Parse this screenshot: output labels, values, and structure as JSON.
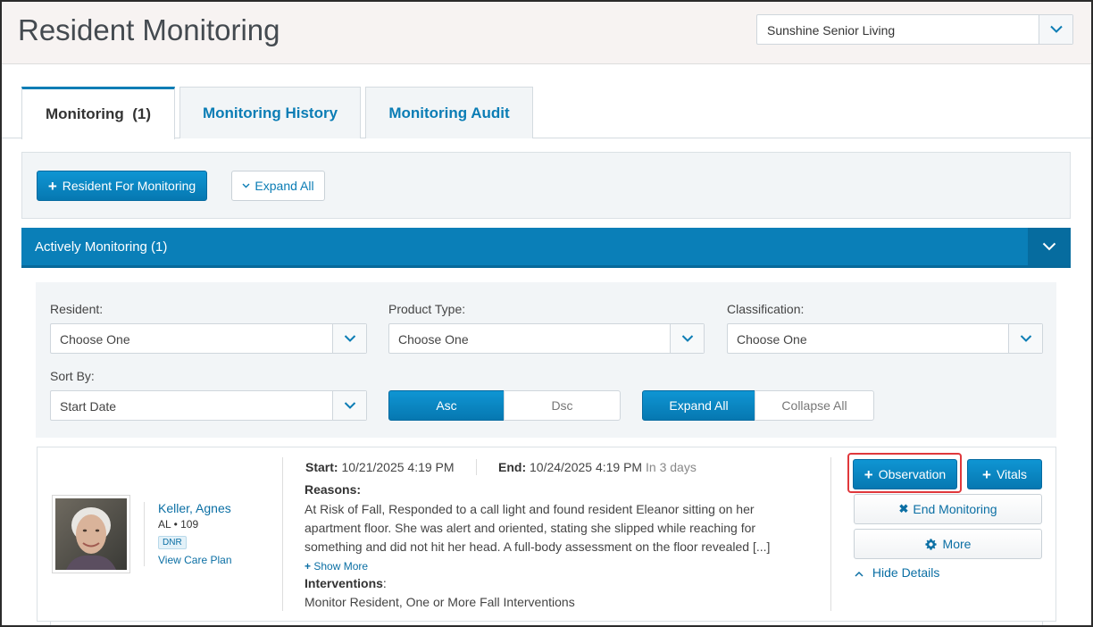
{
  "header": {
    "title": "Resident Monitoring",
    "facility": "Sunshine Senior Living"
  },
  "tabs": [
    {
      "label": "Monitoring  (1)",
      "active": true
    },
    {
      "label": "Monitoring History",
      "active": false
    },
    {
      "label": "Monitoring Audit",
      "active": false
    }
  ],
  "toolbar": {
    "add_resident_label": "Resident For Monitoring",
    "expand_all_label": "Expand All"
  },
  "section": {
    "title": "Actively Monitoring (1)"
  },
  "filters": {
    "resident_label": "Resident:",
    "resident_value": "Choose One",
    "product_type_label": "Product Type:",
    "product_type_value": "Choose One",
    "classification_label": "Classification:",
    "classification_value": "Choose One",
    "sort_by_label": "Sort By:",
    "sort_by_value": "Start Date",
    "asc_label": "Asc",
    "dsc_label": "Dsc",
    "expand_all_label": "Expand All",
    "collapse_all_label": "Collapse All"
  },
  "resident": {
    "name": "Keller, Agnes",
    "level": "AL",
    "room": "109",
    "badge": "DNR",
    "care_plan_link": "View Care Plan",
    "start_label": "Start:",
    "start_value": "10/21/2025 4:19 PM",
    "end_label": "End:",
    "end_value": "10/24/2025 4:19 PM",
    "end_relative": "In 3 days",
    "reasons_label": "Reasons:",
    "reasons_text": "At Risk of Fall, Responded to a call light and found resident Eleanor sitting on her apartment floor. She was alert and oriented, stating she slipped while reaching for something and did not hit her head. A full-body assessment on the floor revealed [...]",
    "show_more": "Show More",
    "interventions_label": "Interventions",
    "interventions_colon": ":",
    "interventions_text": "Monitor Resident, One or More Fall Interventions"
  },
  "actions": {
    "observation_label": "Observation",
    "vitals_label": "Vitals",
    "end_monitoring_label": "End Monitoring",
    "more_label": "More",
    "hide_details_label": "Hide Details"
  },
  "colors": {
    "primary": "#0a86c4",
    "section_bar": "#0a7fb8",
    "link": "#0b6fa4",
    "highlight": "#e0383c"
  }
}
